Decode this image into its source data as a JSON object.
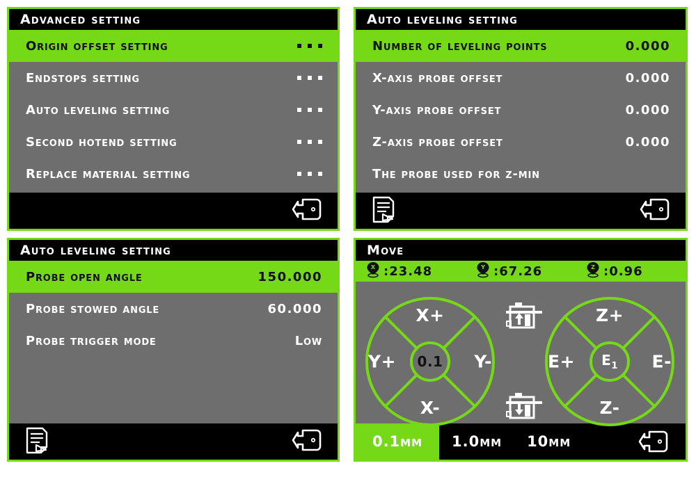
{
  "colors": {
    "accent_green": "#76d918",
    "panel_gray": "#6e6e6e",
    "panel_black": "#000000",
    "text_white": "#ffffff",
    "text_dark": "#111111"
  },
  "panels": {
    "advanced": {
      "title": "Advanced Setting",
      "rows": [
        {
          "label": "Origin offset Setting",
          "value": "...",
          "selected": true
        },
        {
          "label": "Endstops Setting",
          "value": "...",
          "selected": false
        },
        {
          "label": "Auto leveling Setting",
          "value": "...",
          "selected": false
        },
        {
          "label": "Second hotend Setting",
          "value": "...",
          "selected": false
        },
        {
          "label": "Replace material Setting",
          "value": "...",
          "selected": false
        }
      ],
      "footer": {
        "save_icon": "document-pencil-icon",
        "back_icon": "back-arrow-icon",
        "show_save": false
      }
    },
    "autolevel": {
      "title": "Auto leveling Setting",
      "rows": [
        {
          "label": "Number of leveling points",
          "value": "0.000",
          "selected": true
        },
        {
          "label": "X-axis probe offset",
          "value": "0.000",
          "selected": false
        },
        {
          "label": "Y-axis probe offset",
          "value": "0.000",
          "selected": false
        },
        {
          "label": "Z-axis probe offset",
          "value": "0.000",
          "selected": false
        },
        {
          "label": "The probe used for Z-min",
          "value": "",
          "selected": false
        }
      ],
      "footer": {
        "save_icon": "document-pencil-icon",
        "back_icon": "back-arrow-icon",
        "show_save": true
      }
    },
    "probe": {
      "title": "Auto leveling Setting",
      "rows": [
        {
          "label": "Probe open angle",
          "value": "150.000",
          "selected": true
        },
        {
          "label": "Probe stowed angle",
          "value": "60.000",
          "selected": false
        },
        {
          "label": "Probe trigger mode",
          "value": "Low",
          "selected": false
        }
      ],
      "footer": {
        "save_icon": "document-pencil-icon",
        "back_icon": "back-arrow-icon",
        "show_save": true
      }
    },
    "move": {
      "title": "Move",
      "coords": [
        {
          "axis": "X",
          "value": ":23.48"
        },
        {
          "axis": "Y",
          "value": ":67.26"
        },
        {
          "axis": "Z",
          "value": ":0.96"
        }
      ],
      "wheel_xy": {
        "top": "X+",
        "left": "Y+",
        "right": "Y-",
        "bottom": "X-",
        "hub": "0.1"
      },
      "wheel_ze": {
        "top": "Z+",
        "left": "E+",
        "right": "E-",
        "bottom": "Z-",
        "hub_main": "E",
        "hub_sub": "1"
      },
      "servo_up_icon": "servo-up-icon",
      "servo_down_icon": "servo-down-icon",
      "steps": [
        {
          "label": "0.1mm",
          "active": true
        },
        {
          "label": "1.0mm",
          "active": false
        },
        {
          "label": "10mm",
          "active": false
        }
      ],
      "back_icon": "back-arrow-icon"
    }
  }
}
